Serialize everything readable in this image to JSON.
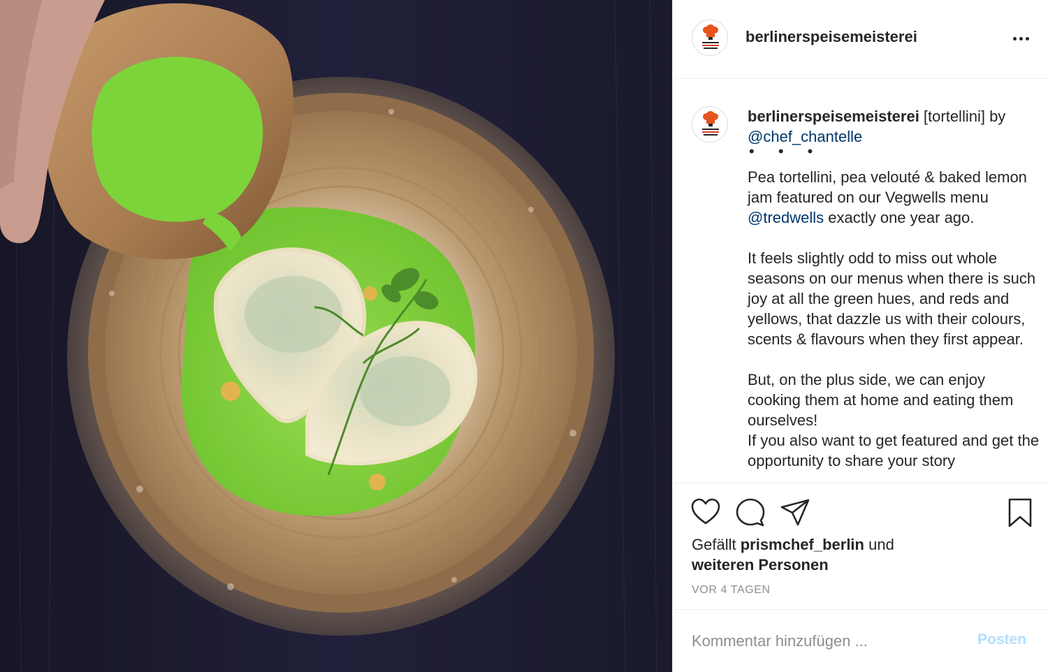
{
  "post": {
    "image": {
      "alt_name": "pea-tortellini-photo"
    },
    "header": {
      "username": "berlinerspeisemeisterei",
      "more_icon": "more-horizontal-icon"
    },
    "caption": {
      "username": "berlinerspeisemeisterei",
      "intro": " [tortellini] by",
      "mention_chef": "@chef_chantelle",
      "dots": "• • •",
      "p1_part1": "Pea tortellini, pea velouté & baked lemon jam featured on our Vegwells menu ",
      "p1_mention": "@tredwells",
      "p1_part2": " exactly one year ago.",
      "p2": "It feels slightly odd to miss out whole seasons on our menus when there is such joy at all the green hues, and reds and yellows, that dazzle us with their colours, scents & flavours when they first appear.",
      "p3": "But, on the plus side, we can enjoy cooking them at home and eating them ourselves!",
      "p4": "If you also want to get featured and get the opportunity to share your story"
    },
    "actions": {
      "like_icon": "heart-icon",
      "comment_icon": "speech-bubble-icon",
      "share_icon": "paper-plane-icon",
      "save_icon": "bookmark-icon"
    },
    "likes": {
      "prefix": "Gefällt ",
      "user": "prismchef_berlin",
      "middle": " und",
      "others": "weiteren Personen"
    },
    "timestamp": "VOR 4 TAGEN",
    "comment": {
      "placeholder": "Kommentar hinzufügen ...",
      "post_label": "Posten"
    },
    "colors": {
      "text": "#262626",
      "link": "#00376b",
      "muted": "#8e8e8e",
      "post_button_disabled": "#b2dffc",
      "divider": "#efefef",
      "pea_green": "#7cd43a",
      "table_dark": "#1b1a2a"
    }
  }
}
